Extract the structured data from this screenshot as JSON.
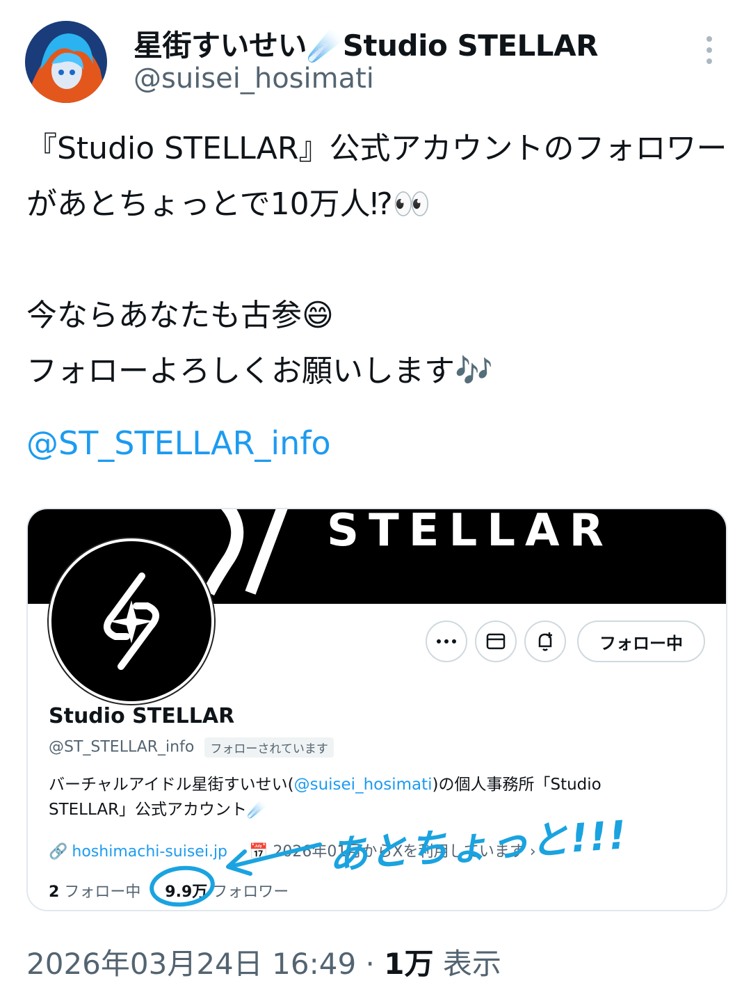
{
  "author": {
    "display_name": "星街すいせい☄️Studio STELLAR",
    "handle": "@suisei_hosimati"
  },
  "tweet": {
    "text": "『Studio STELLAR』公式アカウントのフォロワーがあとちょっとで10万人⁉👀\n\n今ならあなたも古参😄\nフォローよろしくお願いします🎶",
    "mention": "@ST_STELLAR_info"
  },
  "card": {
    "banner_text": "STELLAR",
    "profile_name": "Studio STELLAR",
    "profile_handle": "@ST_STELLAR_info",
    "follows_you_badge": "フォローされています",
    "follow_button": "フォロー中",
    "bio_prefix": "バーチャルアイドル星街すいせい(",
    "bio_mention": "@suisei_hosimati",
    "bio_suffix": ")の個人事務所「Studio STELLAR」公式アカウント☄️",
    "url": "hoshimachi-suisei.jp",
    "joined": "2026年01月からXを利用しています",
    "following_count": "2",
    "following_label": "フォロー中",
    "followers_count": "9.9万",
    "followers_label": "フォロワー",
    "annotation": "あとちょっと!!!"
  },
  "footer": {
    "timestamp": "2026年03月24日 16:49 · ",
    "views_count": "1万",
    "views_label": "表示"
  },
  "colors": {
    "link": "#1d9bf0",
    "annotation": "#1aa3e0",
    "muted": "#536471"
  },
  "icons": [
    "more-vertical-icon",
    "more-horizontal-icon",
    "mail-icon",
    "notification-add-icon",
    "link-icon",
    "calendar-icon",
    "chevron-right-icon"
  ]
}
